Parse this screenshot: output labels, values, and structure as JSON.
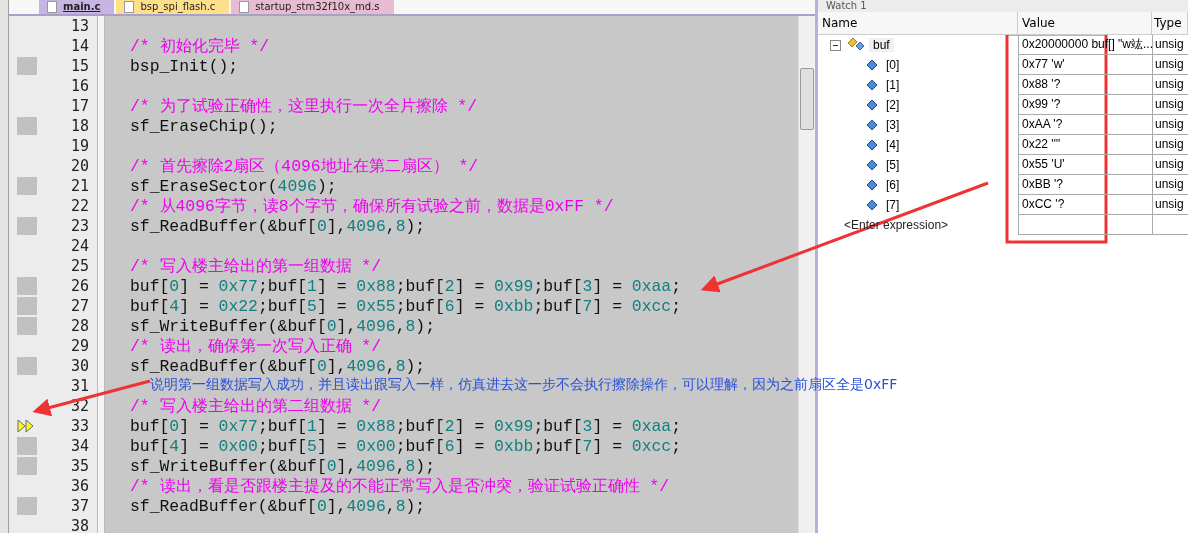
{
  "tabs": [
    {
      "label": "main.c",
      "selected": true,
      "color": "#c8b4e0"
    },
    {
      "label": "bsp_spi_flash.c",
      "selected": false,
      "color": "#ffe08a"
    },
    {
      "label": "startup_stm32f10x_md.s",
      "selected": false,
      "color": "#e8bcd0"
    }
  ],
  "editor": {
    "lines": [
      {
        "number": "13",
        "executable": false,
        "current": false
      },
      {
        "number": "14",
        "executable": false,
        "current": false,
        "segments": [
          {
            "kind": "comment",
            "text": "/* 初始化完毕 */"
          }
        ]
      },
      {
        "number": "15",
        "executable": true,
        "current": false,
        "segments": [
          {
            "kind": "code",
            "text": "bsp_Init();"
          }
        ]
      },
      {
        "number": "16",
        "executable": false,
        "current": false
      },
      {
        "number": "17",
        "executable": false,
        "current": false,
        "segments": [
          {
            "kind": "comment",
            "text": "/* 为了试验正确性，这里执行一次全片擦除 */"
          }
        ]
      },
      {
        "number": "18",
        "executable": true,
        "current": false,
        "segments": [
          {
            "kind": "code",
            "text": "sf_EraseChip();"
          }
        ]
      },
      {
        "number": "19",
        "executable": false,
        "current": false
      },
      {
        "number": "20",
        "executable": false,
        "current": false,
        "segments": [
          {
            "kind": "comment",
            "text": "/* 首先擦除2扇区（4096地址在第二扇区） */"
          }
        ]
      },
      {
        "number": "21",
        "executable": true,
        "current": false,
        "segments": [
          {
            "kind": "code",
            "text": "sf_EraseSector("
          },
          {
            "kind": "num",
            "text": "4096"
          },
          {
            "kind": "code",
            "text": ");"
          }
        ]
      },
      {
        "number": "22",
        "executable": false,
        "current": false,
        "segments": [
          {
            "kind": "comment",
            "text": "/* 从4096字节，读8个字节，确保所有试验之前，数据是0xFF */"
          }
        ]
      },
      {
        "number": "23",
        "executable": true,
        "current": false,
        "segments": [
          {
            "kind": "code",
            "text": "sf_ReadBuffer(&buf["
          },
          {
            "kind": "num",
            "text": "0"
          },
          {
            "kind": "code",
            "text": "],"
          },
          {
            "kind": "num",
            "text": "4096"
          },
          {
            "kind": "code",
            "text": ","
          },
          {
            "kind": "num",
            "text": "8"
          },
          {
            "kind": "code",
            "text": ");"
          }
        ]
      },
      {
        "number": "24",
        "executable": false,
        "current": false
      },
      {
        "number": "25",
        "executable": false,
        "current": false,
        "segments": [
          {
            "kind": "comment",
            "text": "/* 写入楼主给出的第一组数据 */"
          }
        ]
      },
      {
        "number": "26",
        "executable": true,
        "current": false,
        "segments": [
          {
            "kind": "code",
            "text": "buf["
          },
          {
            "kind": "num",
            "text": "0"
          },
          {
            "kind": "code",
            "text": "] = "
          },
          {
            "kind": "num",
            "text": "0x77"
          },
          {
            "kind": "code",
            "text": ";buf["
          },
          {
            "kind": "num",
            "text": "1"
          },
          {
            "kind": "code",
            "text": "] = "
          },
          {
            "kind": "num",
            "text": "0x88"
          },
          {
            "kind": "code",
            "text": ";buf["
          },
          {
            "kind": "num",
            "text": "2"
          },
          {
            "kind": "code",
            "text": "] = "
          },
          {
            "kind": "num",
            "text": "0x99"
          },
          {
            "kind": "code",
            "text": ";buf["
          },
          {
            "kind": "num",
            "text": "3"
          },
          {
            "kind": "code",
            "text": "] = "
          },
          {
            "kind": "num",
            "text": "0xaa"
          },
          {
            "kind": "code",
            "text": ";"
          }
        ]
      },
      {
        "number": "27",
        "executable": true,
        "current": false,
        "segments": [
          {
            "kind": "code",
            "text": "buf["
          },
          {
            "kind": "num",
            "text": "4"
          },
          {
            "kind": "code",
            "text": "] = "
          },
          {
            "kind": "num",
            "text": "0x22"
          },
          {
            "kind": "code",
            "text": ";buf["
          },
          {
            "kind": "num",
            "text": "5"
          },
          {
            "kind": "code",
            "text": "] = "
          },
          {
            "kind": "num",
            "text": "0x55"
          },
          {
            "kind": "code",
            "text": ";buf["
          },
          {
            "kind": "num",
            "text": "6"
          },
          {
            "kind": "code",
            "text": "] = "
          },
          {
            "kind": "num",
            "text": "0xbb"
          },
          {
            "kind": "code",
            "text": ";buf["
          },
          {
            "kind": "num",
            "text": "7"
          },
          {
            "kind": "code",
            "text": "] = "
          },
          {
            "kind": "num",
            "text": "0xcc"
          },
          {
            "kind": "code",
            "text": ";"
          }
        ]
      },
      {
        "number": "28",
        "executable": true,
        "current": false,
        "segments": [
          {
            "kind": "code",
            "text": "sf_WriteBuffer(&buf["
          },
          {
            "kind": "num",
            "text": "0"
          },
          {
            "kind": "code",
            "text": "],"
          },
          {
            "kind": "num",
            "text": "4096"
          },
          {
            "kind": "code",
            "text": ","
          },
          {
            "kind": "num",
            "text": "8"
          },
          {
            "kind": "code",
            "text": ");"
          }
        ]
      },
      {
        "number": "29",
        "executable": false,
        "current": false,
        "segments": [
          {
            "kind": "comment",
            "text": "/* 读出，确保第一次写入正确 */"
          }
        ]
      },
      {
        "number": "30",
        "executable": true,
        "current": false,
        "segments": [
          {
            "kind": "code",
            "text": "sf_ReadBuffer(&buf["
          },
          {
            "kind": "num",
            "text": "0"
          },
          {
            "kind": "code",
            "text": "],"
          },
          {
            "kind": "num",
            "text": "4096"
          },
          {
            "kind": "code",
            "text": ","
          },
          {
            "kind": "num",
            "text": "8"
          },
          {
            "kind": "code",
            "text": ");"
          }
        ]
      },
      {
        "number": "31",
        "executable": false,
        "current": false
      },
      {
        "number": "32",
        "executable": false,
        "current": false,
        "segments": [
          {
            "kind": "comment",
            "text": "/* 写入楼主给出的第二组数据 */"
          }
        ]
      },
      {
        "number": "33",
        "executable": false,
        "current": true,
        "segments": [
          {
            "kind": "code",
            "text": "buf["
          },
          {
            "kind": "num",
            "text": "0"
          },
          {
            "kind": "code",
            "text": "] = "
          },
          {
            "kind": "num",
            "text": "0x77"
          },
          {
            "kind": "code",
            "text": ";buf["
          },
          {
            "kind": "num",
            "text": "1"
          },
          {
            "kind": "code",
            "text": "] = "
          },
          {
            "kind": "num",
            "text": "0x88"
          },
          {
            "kind": "code",
            "text": ";buf["
          },
          {
            "kind": "num",
            "text": "2"
          },
          {
            "kind": "code",
            "text": "] = "
          },
          {
            "kind": "num",
            "text": "0x99"
          },
          {
            "kind": "code",
            "text": ";buf["
          },
          {
            "kind": "num",
            "text": "3"
          },
          {
            "kind": "code",
            "text": "] = "
          },
          {
            "kind": "num",
            "text": "0xaa"
          },
          {
            "kind": "code",
            "text": ";"
          }
        ]
      },
      {
        "number": "34",
        "executable": true,
        "current": false,
        "segments": [
          {
            "kind": "code",
            "text": "buf["
          },
          {
            "kind": "num",
            "text": "4"
          },
          {
            "kind": "code",
            "text": "] = "
          },
          {
            "kind": "num",
            "text": "0x00"
          },
          {
            "kind": "code",
            "text": ";buf["
          },
          {
            "kind": "num",
            "text": "5"
          },
          {
            "kind": "code",
            "text": "] = "
          },
          {
            "kind": "num",
            "text": "0x00"
          },
          {
            "kind": "code",
            "text": ";buf["
          },
          {
            "kind": "num",
            "text": "6"
          },
          {
            "kind": "code",
            "text": "] = "
          },
          {
            "kind": "num",
            "text": "0xbb"
          },
          {
            "kind": "code",
            "text": ";buf["
          },
          {
            "kind": "num",
            "text": "7"
          },
          {
            "kind": "code",
            "text": "] = "
          },
          {
            "kind": "num",
            "text": "0xcc"
          },
          {
            "kind": "code",
            "text": ";"
          }
        ]
      },
      {
        "number": "35",
        "executable": true,
        "current": false,
        "segments": [
          {
            "kind": "code",
            "text": "sf_WriteBuffer(&buf["
          },
          {
            "kind": "num",
            "text": "0"
          },
          {
            "kind": "code",
            "text": "],"
          },
          {
            "kind": "num",
            "text": "4096"
          },
          {
            "kind": "code",
            "text": ","
          },
          {
            "kind": "num",
            "text": "8"
          },
          {
            "kind": "code",
            "text": ");"
          }
        ]
      },
      {
        "number": "36",
        "executable": false,
        "current": false,
        "segments": [
          {
            "kind": "comment",
            "text": "/* 读出，看是否跟楼主提及的不能正常写入是否冲突，验证试验正确性 */"
          }
        ]
      },
      {
        "number": "37",
        "executable": true,
        "current": false,
        "segments": [
          {
            "kind": "code",
            "text": "sf_ReadBuffer(&buf["
          },
          {
            "kind": "num",
            "text": "0"
          },
          {
            "kind": "code",
            "text": "],"
          },
          {
            "kind": "num",
            "text": "4096"
          },
          {
            "kind": "code",
            "text": ","
          },
          {
            "kind": "num",
            "text": "8"
          },
          {
            "kind": "code",
            "text": ");"
          }
        ]
      },
      {
        "number": "38",
        "executable": false,
        "current": false
      }
    ]
  },
  "annotation": "说明第一组数据写入成功，并且读出跟写入一样，仿真进去这一步不会执行擦除操作，可以理解，因为之前扇区全是0xFF",
  "watch": {
    "title": "Watch 1",
    "columns": [
      "Name",
      "Value",
      "Type"
    ],
    "root": {
      "name": "buf",
      "value": "0x20000000 buf[] \"w竑...",
      "type": "unsig",
      "expanded": true,
      "children": [
        {
          "name": "[0]",
          "value": "0x77 'w'",
          "type": "unsig"
        },
        {
          "name": "[1]",
          "value": "0x88 '?",
          "type": "unsig"
        },
        {
          "name": "[2]",
          "value": "0x99 '?",
          "type": "unsig"
        },
        {
          "name": "[3]",
          "value": "0xAA '?",
          "type": "unsig"
        },
        {
          "name": "[4]",
          "value": "0x22 '\"'",
          "type": "unsig"
        },
        {
          "name": "[5]",
          "value": "0x55 'U'",
          "type": "unsig"
        },
        {
          "name": "[6]",
          "value": "0xBB '?",
          "type": "unsig"
        },
        {
          "name": "[7]",
          "value": "0xCC '?",
          "type": "unsig"
        }
      ]
    },
    "placeholder": "<Enter expression>"
  }
}
